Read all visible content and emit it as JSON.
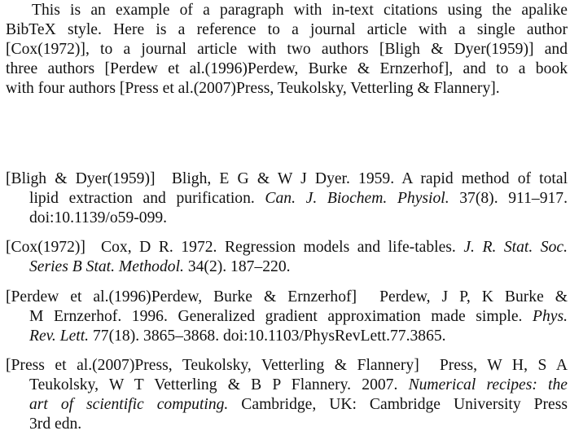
{
  "paragraph": {
    "lines": [
      "This is an example of a paragraph with in-text citations using the apalike",
      "BibTeX style.  Here is a reference to a journal article with a single author",
      "[Cox(1972)], to a journal article with two authors [Bligh & Dyer(1959)] and",
      "three authors [Perdew et al.(1996)Perdew, Burke & Ernzerhof], and to a book",
      "with four authors [Press et al.(2007)Press, Teukolsky, Vetterling & Flannery]."
    ]
  },
  "references": [
    {
      "label": "[Bligh & Dyer(1959)]",
      "line1": "Bligh, E G & W J Dyer. 1959.  A rapid method of total",
      "line2_pre": "lipid extraction and purification. ",
      "line2_it": "Can. J. Biochem. Physiol.",
      "line2_post": " 37(8). 911–917.",
      "line3": "doi:10.1139/o59-099."
    },
    {
      "label": "[Cox(1972)]",
      "line1_pre": "Cox, D R. 1972. Regression models and life-tables. ",
      "line1_it": "J. R. Stat. Soc.",
      "line2_it": "Series B Stat. Methodol.",
      "line2_post": " 34(2). 187–220."
    },
    {
      "label": "[Perdew et al.(1996)Perdew, Burke & Ernzerhof]",
      "line1": "Perdew,  J P,  K  Burke  &",
      "line2_pre": "M Ernzerhof. 1996. Generalized gradient approximation made simple. ",
      "line2_it": "Phys.",
      "line3_it": "Rev. Lett.",
      "line3_post": " 77(18). 3865–3868. doi:10.1103/PhysRevLett.77.3865."
    },
    {
      "label": "[Press et al.(2007)Press, Teukolsky, Vetterling & Flannery]",
      "line1": "Press,  W H,  S A",
      "line2_pre": "Teukolsky, W T Vetterling & B P Flannery. 2007. ",
      "line2_it": "Numerical recipes: the",
      "line3_it": "art of scientific computing.",
      "line3_post": "  Cambridge, UK: Cambridge University Press",
      "line4": "3rd edn."
    }
  ]
}
